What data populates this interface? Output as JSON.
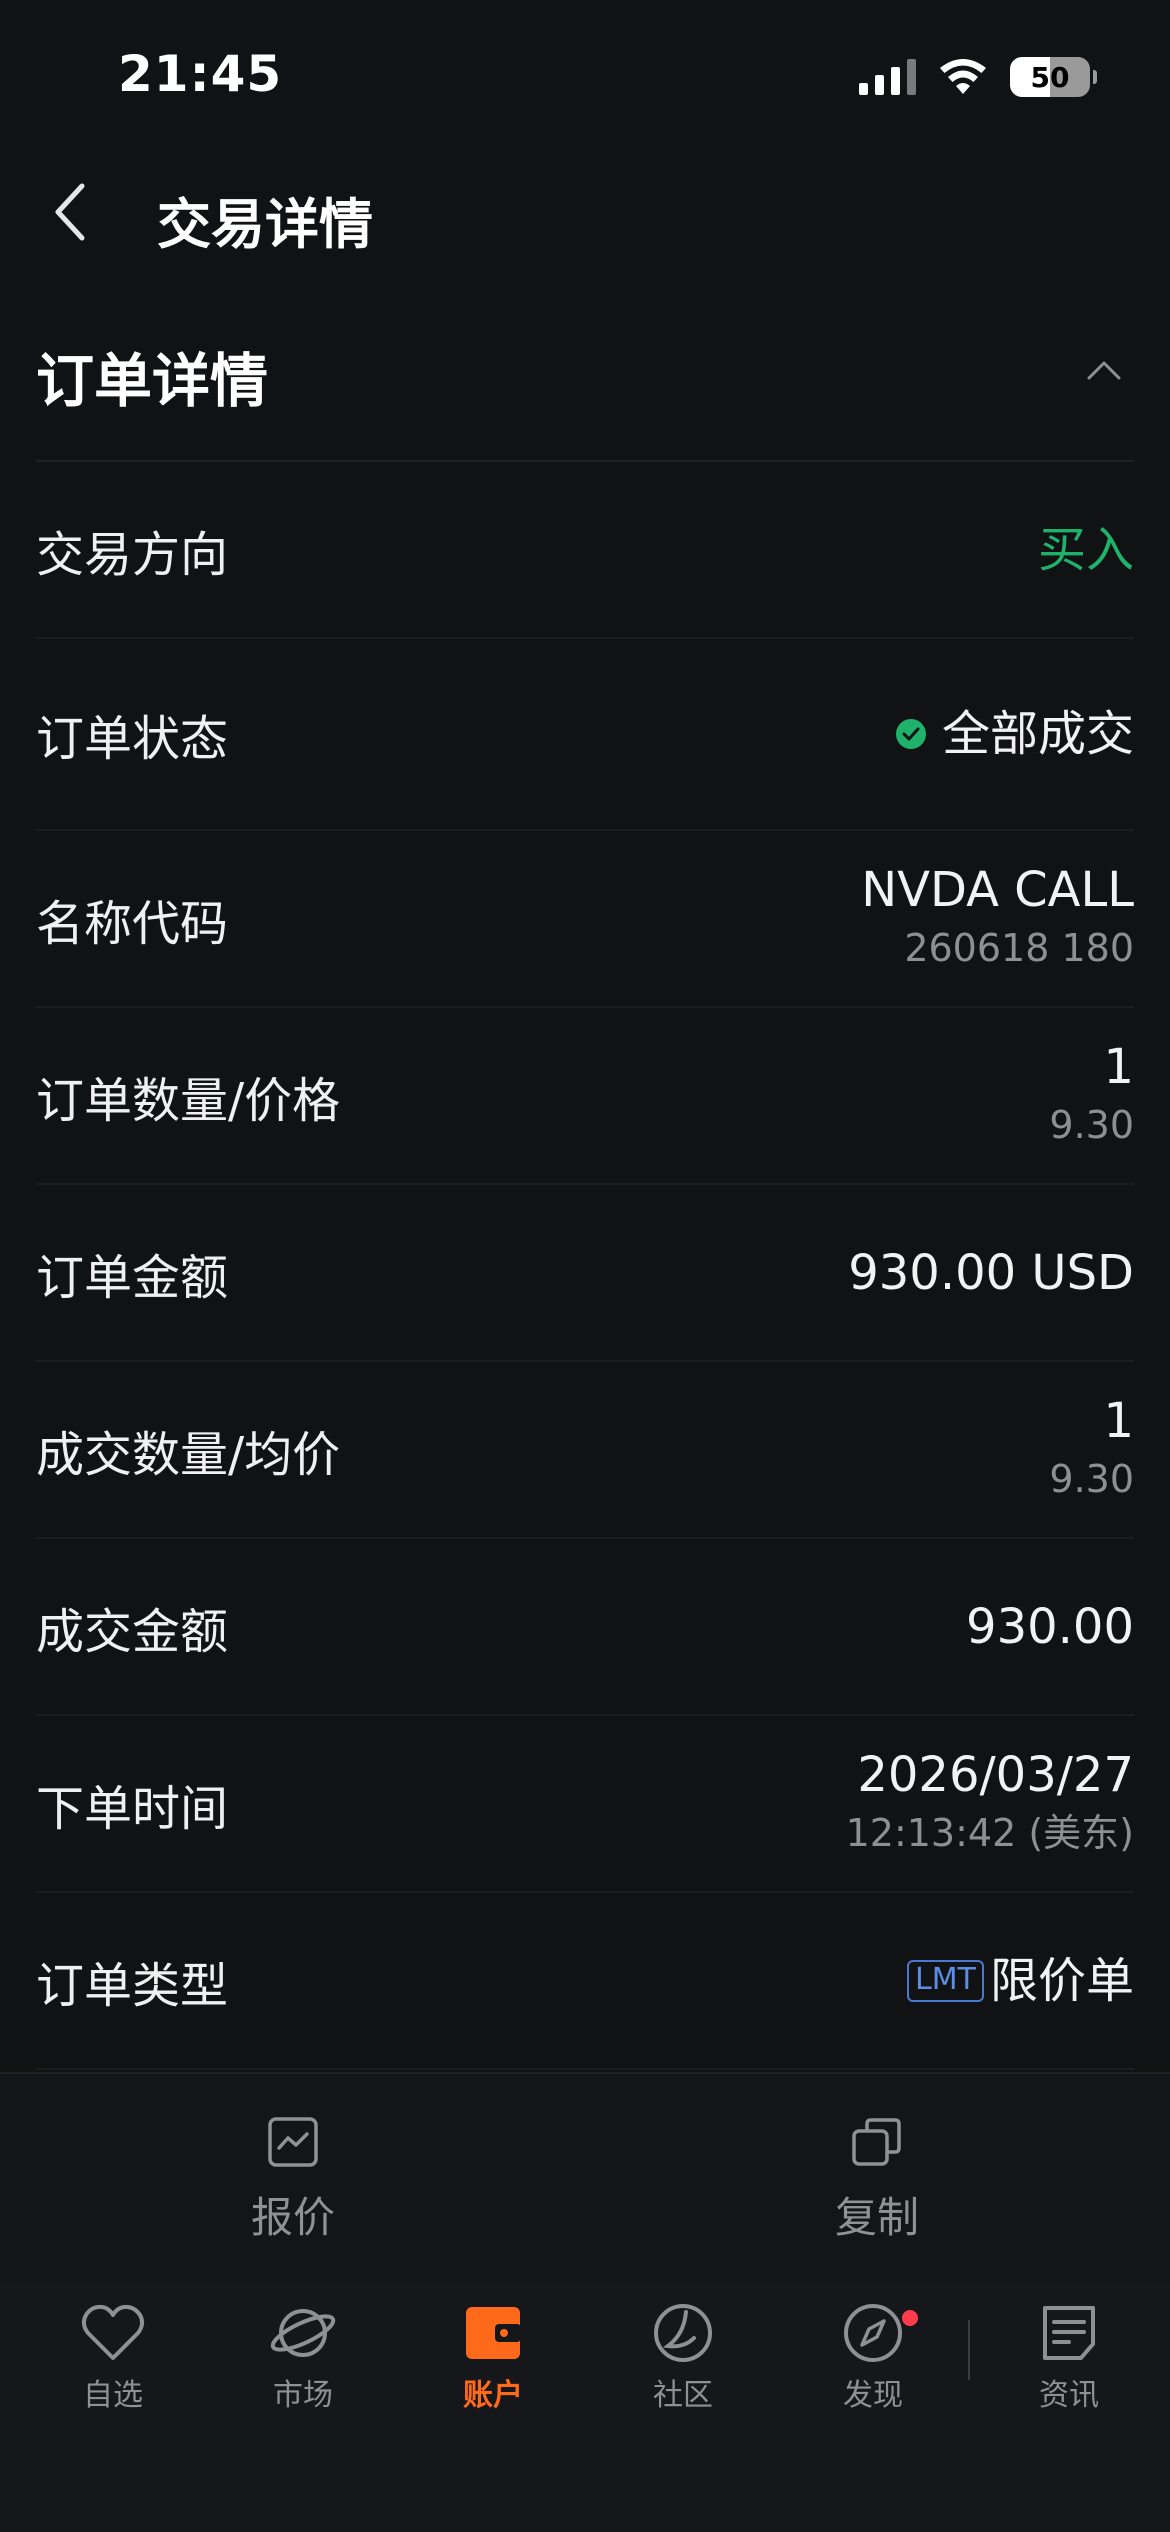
{
  "status_bar": {
    "time": "21:45",
    "battery": "50"
  },
  "header": {
    "title": "交易详情"
  },
  "section": {
    "title": "订单详情"
  },
  "rows": [
    {
      "label": "交易方向",
      "value": "买入"
    },
    {
      "label": "订单状态",
      "value": "全部成交"
    },
    {
      "label": "名称代码",
      "value": "NVDA CALL",
      "sub": "260618 180"
    },
    {
      "label": "订单数量/价格",
      "value": "1",
      "sub": "9.30"
    },
    {
      "label": "订单金额",
      "value": "930.00 USD"
    },
    {
      "label": "成交数量/均价",
      "value": "1",
      "sub": "9.30"
    },
    {
      "label": "成交金额",
      "value": "930.00"
    },
    {
      "label": "下单时间",
      "value": "2026/03/27",
      "sub": "12:13:42 (美东)"
    },
    {
      "label": "订单类型",
      "badge": "LMT",
      "value": "限价单"
    }
  ],
  "actions": {
    "quote": "报价",
    "copy": "复制"
  },
  "tabs": [
    {
      "label": "自选",
      "icon": "heart-icon"
    },
    {
      "label": "市场",
      "icon": "planet-icon"
    },
    {
      "label": "账户",
      "icon": "wallet-icon",
      "active": true
    },
    {
      "label": "社区",
      "icon": "community-icon"
    },
    {
      "label": "发现",
      "icon": "compass-icon"
    },
    {
      "label": "资讯",
      "icon": "news-icon"
    }
  ],
  "colors": {
    "background": "#111214",
    "buy_green": "#1fb26b",
    "accent_orange": "#ff6a1a",
    "badge_blue": "#4a78d0",
    "notification_red": "#ff3b4e"
  }
}
